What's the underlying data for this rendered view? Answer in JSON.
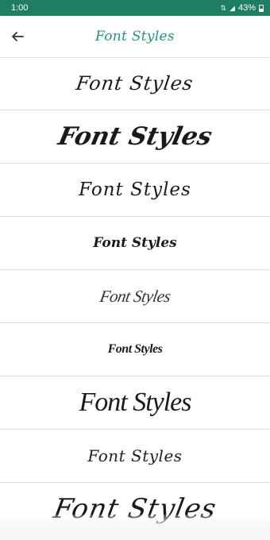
{
  "status_bar": {
    "time": "1:00",
    "battery_text": "43%",
    "icons": [
      "signal-icon",
      "wifi-icon",
      "battery-icon"
    ]
  },
  "app_bar": {
    "title": "Font Styles",
    "back_icon": "back-arrow-icon",
    "title_color": "#2a8f86"
  },
  "font_samples": [
    "Font Styles",
    "Font Styles",
    "Font Styles",
    "Font Styles",
    "Font Styles",
    "Font Styles",
    "Font Styles",
    "Font Styles",
    "Font Styles"
  ],
  "colors": {
    "status_bar": "#1e7d63",
    "accent": "#2a8f86",
    "divider": "#dcdcdc"
  }
}
